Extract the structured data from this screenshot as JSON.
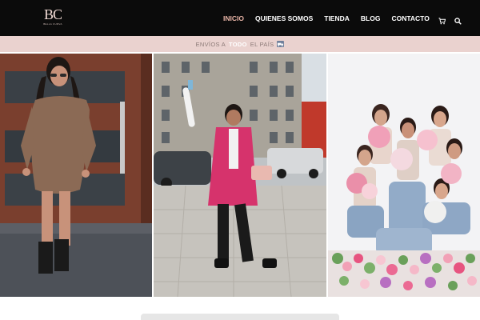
{
  "brand": {
    "logo_text": "BC",
    "tagline": "BELLA CURVA"
  },
  "nav": {
    "items": [
      {
        "label": "INICIO",
        "active": true
      },
      {
        "label": "QUIENES SOMOS",
        "active": false
      },
      {
        "label": "TIENDA",
        "active": false
      },
      {
        "label": "BLOG",
        "active": false
      },
      {
        "label": "CONTACTO",
        "active": false
      }
    ],
    "cart_icon": "cart-icon",
    "search_icon": "search-icon",
    "active_color": "#e8b4a6"
  },
  "banner": {
    "text_before": "ENVÍOS A",
    "text_highlight": "TODO",
    "text_after": "EL PAÍS",
    "icon": "truck-icon",
    "background": "#ead2cf"
  },
  "gallery": {
    "photos": [
      {
        "name": "woman-brown-dress-door"
      },
      {
        "name": "woman-pink-vest-street"
      },
      {
        "name": "group-women-flowers"
      }
    ]
  },
  "colors": {
    "header_bg": "#0b0b0b",
    "accent": "#e8b4a6"
  }
}
